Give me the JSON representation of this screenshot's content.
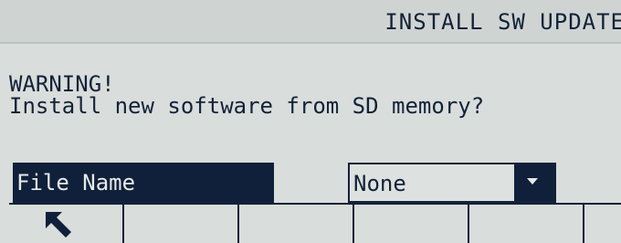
{
  "header": {
    "title": "INSTALL SW UPDATE"
  },
  "message": {
    "line1": "WARNING!",
    "line2": "Install new software from SD memory?"
  },
  "file_field": {
    "label": "File Name",
    "selected": "None",
    "dropdown_icon": "triangle-down-icon"
  },
  "softkeys": [
    {
      "icon": "arrow-up-left-icon"
    },
    {
      "icon": ""
    },
    {
      "icon": ""
    },
    {
      "icon": ""
    },
    {
      "icon": ""
    },
    {
      "icon": ""
    }
  ],
  "colors": {
    "background": "#d9dddb",
    "ink": "#10203a"
  }
}
